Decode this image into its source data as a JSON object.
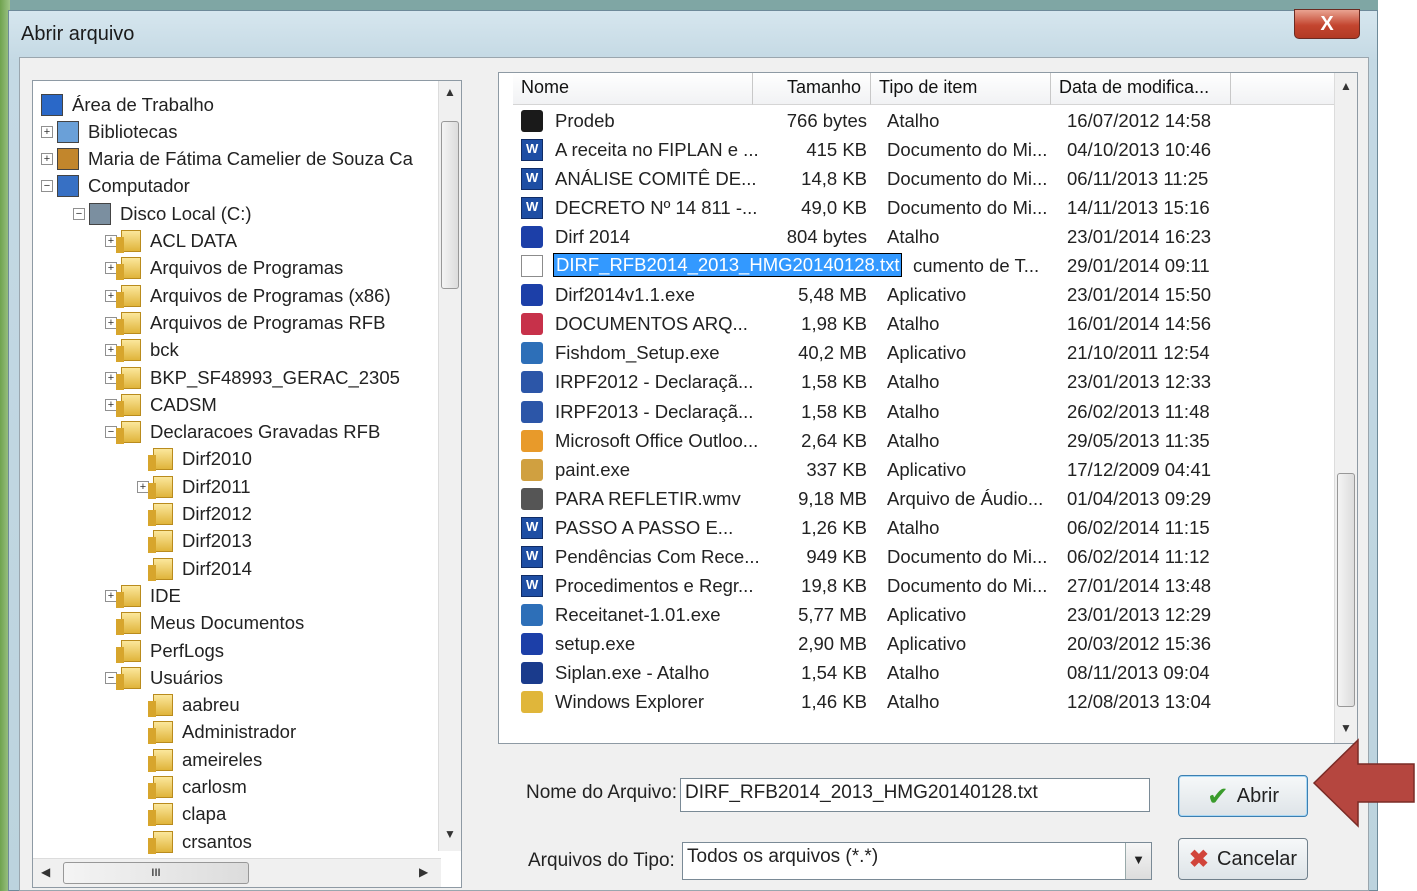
{
  "dialog": {
    "title": "Abrir arquivo",
    "close_label": "X"
  },
  "tree": {
    "items": [
      {
        "label": "Área de Trabalho",
        "icon": "desktop-icon",
        "expander": ""
      },
      {
        "label": "Bibliotecas",
        "icon": "libraries-icon",
        "expander": "+"
      },
      {
        "label": "Maria de Fátima Camelier de Souza Ca",
        "icon": "user-icon",
        "expander": "+"
      },
      {
        "label": "Computador",
        "icon": "computer-icon",
        "expander": "−"
      },
      {
        "label": "Disco Local (C:)",
        "icon": "drive-icon",
        "expander": "−"
      },
      {
        "label": "ACL DATA",
        "icon": "folder-icon",
        "expander": "+"
      },
      {
        "label": "Arquivos de Programas",
        "icon": "folder-icon",
        "expander": "+"
      },
      {
        "label": "Arquivos de Programas (x86)",
        "icon": "folder-icon",
        "expander": "+"
      },
      {
        "label": "Arquivos de Programas RFB",
        "icon": "folder-icon",
        "expander": "+"
      },
      {
        "label": "bck",
        "icon": "folder-icon",
        "expander": "+"
      },
      {
        "label": "BKP_SF48993_GERAC_2305",
        "icon": "folder-icon",
        "expander": "+"
      },
      {
        "label": "CADSM",
        "icon": "folder-icon",
        "expander": "+"
      },
      {
        "label": "Declaracoes Gravadas RFB",
        "icon": "folder-icon",
        "expander": "−"
      },
      {
        "label": "Dirf2010",
        "icon": "folder-icon",
        "expander": ""
      },
      {
        "label": "Dirf2011",
        "icon": "folder-icon",
        "expander": "+"
      },
      {
        "label": "Dirf2012",
        "icon": "folder-icon",
        "expander": ""
      },
      {
        "label": "Dirf2013",
        "icon": "folder-icon",
        "expander": ""
      },
      {
        "label": "Dirf2014",
        "icon": "folder-icon",
        "expander": ""
      },
      {
        "label": "IDE",
        "icon": "folder-icon",
        "expander": "+"
      },
      {
        "label": "Meus Documentos",
        "icon": "folder-icon",
        "expander": ""
      },
      {
        "label": "PerfLogs",
        "icon": "folder-icon",
        "expander": ""
      },
      {
        "label": "Usuários",
        "icon": "folder-icon",
        "expander": "−"
      },
      {
        "label": "aabreu",
        "icon": "folder-icon",
        "expander": ""
      },
      {
        "label": "Administrador",
        "icon": "folder-icon",
        "expander": ""
      },
      {
        "label": "ameireles",
        "icon": "folder-icon",
        "expander": ""
      },
      {
        "label": "carlosm",
        "icon": "folder-icon",
        "expander": ""
      },
      {
        "label": "clapa",
        "icon": "folder-icon",
        "expander": ""
      },
      {
        "label": "crsantos",
        "icon": "folder-icon",
        "expander": ""
      }
    ],
    "hscroll_grip": "III"
  },
  "list": {
    "columns": [
      "Nome",
      "Tamanho",
      "Tipo de item",
      "Data de modifica..."
    ],
    "rows": [
      {
        "name": "Prodeb",
        "size": "766 bytes",
        "type": "Atalho",
        "date": "16/07/2012 14:58",
        "icon": "terminal-icon"
      },
      {
        "name": "A receita no FIPLAN e ...",
        "size": "415 KB",
        "type": "Documento do Mi...",
        "date": "04/10/2013 10:46",
        "icon": "word-doc-icon"
      },
      {
        "name": "ANÁLISE COMITÊ DE...",
        "size": "14,8 KB",
        "type": "Documento do Mi...",
        "date": "06/11/2013 11:25",
        "icon": "word-doc-icon"
      },
      {
        "name": "DECRETO Nº 14 811 -...",
        "size": "49,0 KB",
        "type": "Documento do Mi...",
        "date": "14/11/2013 15:16",
        "icon": "word-doc-icon"
      },
      {
        "name": "Dirf 2014",
        "size": "804 bytes",
        "type": "Atalho",
        "date": "23/01/2014 16:23",
        "icon": "dirf-icon"
      },
      {
        "name": "DIRF_RFB2014_2013_HMG20140128.txt",
        "size": "",
        "type": "cumento de T...",
        "date": "29/01/2014 09:11",
        "icon": "text-file-icon",
        "selected": true
      },
      {
        "name": "Dirf2014v1.1.exe",
        "size": "5,48 MB",
        "type": "Aplicativo",
        "date": "23/01/2014 15:50",
        "icon": "dirf-icon"
      },
      {
        "name": "DOCUMENTOS ARQ...",
        "size": "1,98 KB",
        "type": "Atalho",
        "date": "16/01/2014 14:56",
        "icon": "pdf-icon"
      },
      {
        "name": "Fishdom_Setup.exe",
        "size": "40,2 MB",
        "type": "Aplicativo",
        "date": "21/10/2011 12:54",
        "icon": "setup-icon"
      },
      {
        "name": "IRPF2012 - Declaraçã...",
        "size": "1,58 KB",
        "type": "Atalho",
        "date": "23/01/2013 12:33",
        "icon": "irpf-icon"
      },
      {
        "name": "IRPF2013 - Declaraçã...",
        "size": "1,58 KB",
        "type": "Atalho",
        "date": "26/02/2013 11:48",
        "icon": "irpf-icon"
      },
      {
        "name": "Microsoft Office Outloo...",
        "size": "2,64 KB",
        "type": "Atalho",
        "date": "29/05/2013 11:35",
        "icon": "outlook-icon"
      },
      {
        "name": "paint.exe",
        "size": "337 KB",
        "type": "Aplicativo",
        "date": "17/12/2009 04:41",
        "icon": "paint-icon"
      },
      {
        "name": "PARA REFLETIR.wmv",
        "size": "9,18 MB",
        "type": "Arquivo de Áudio...",
        "date": "01/04/2013 09:29",
        "icon": "video-icon"
      },
      {
        "name": "PASSO  A  PASSO  E...",
        "size": "1,26 KB",
        "type": "Atalho",
        "date": "06/02/2014 11:15",
        "icon": "word-doc-icon"
      },
      {
        "name": "Pendências Com Rece...",
        "size": "949 KB",
        "type": "Documento do Mi...",
        "date": "06/02/2014 11:12",
        "icon": "word-doc-icon"
      },
      {
        "name": "Procedimentos e Regr...",
        "size": "19,8 KB",
        "type": "Documento do Mi...",
        "date": "27/01/2014 13:48",
        "icon": "word-doc-icon"
      },
      {
        "name": "Receitanet-1.01.exe",
        "size": "5,77 MB",
        "type": "Aplicativo",
        "date": "23/01/2013 12:29",
        "icon": "setup-icon"
      },
      {
        "name": "setup.exe",
        "size": "2,90 MB",
        "type": "Aplicativo",
        "date": "20/03/2012 15:36",
        "icon": "dirf-icon"
      },
      {
        "name": "Siplan.exe - Atalho",
        "size": "1,54 KB",
        "type": "Atalho",
        "date": "08/11/2013 09:04",
        "icon": "siplan-icon"
      },
      {
        "name": "Windows Explorer",
        "size": "1,46 KB",
        "type": "Atalho",
        "date": "12/08/2013 13:04",
        "icon": "explorer-icon"
      }
    ]
  },
  "footer": {
    "filename_label": "Nome do Arquivo:",
    "filename_value": "DIRF_RFB2014_2013_HMG20140128.txt",
    "filetype_label": "Arquivos do Tipo:",
    "filetype_value": "Todos os arquivos (*.*)",
    "open_label": "Abrir",
    "cancel_label": "Cancelar"
  },
  "colors": {
    "selection": "#3399ff",
    "annotation_arrow": "#b5463f"
  }
}
